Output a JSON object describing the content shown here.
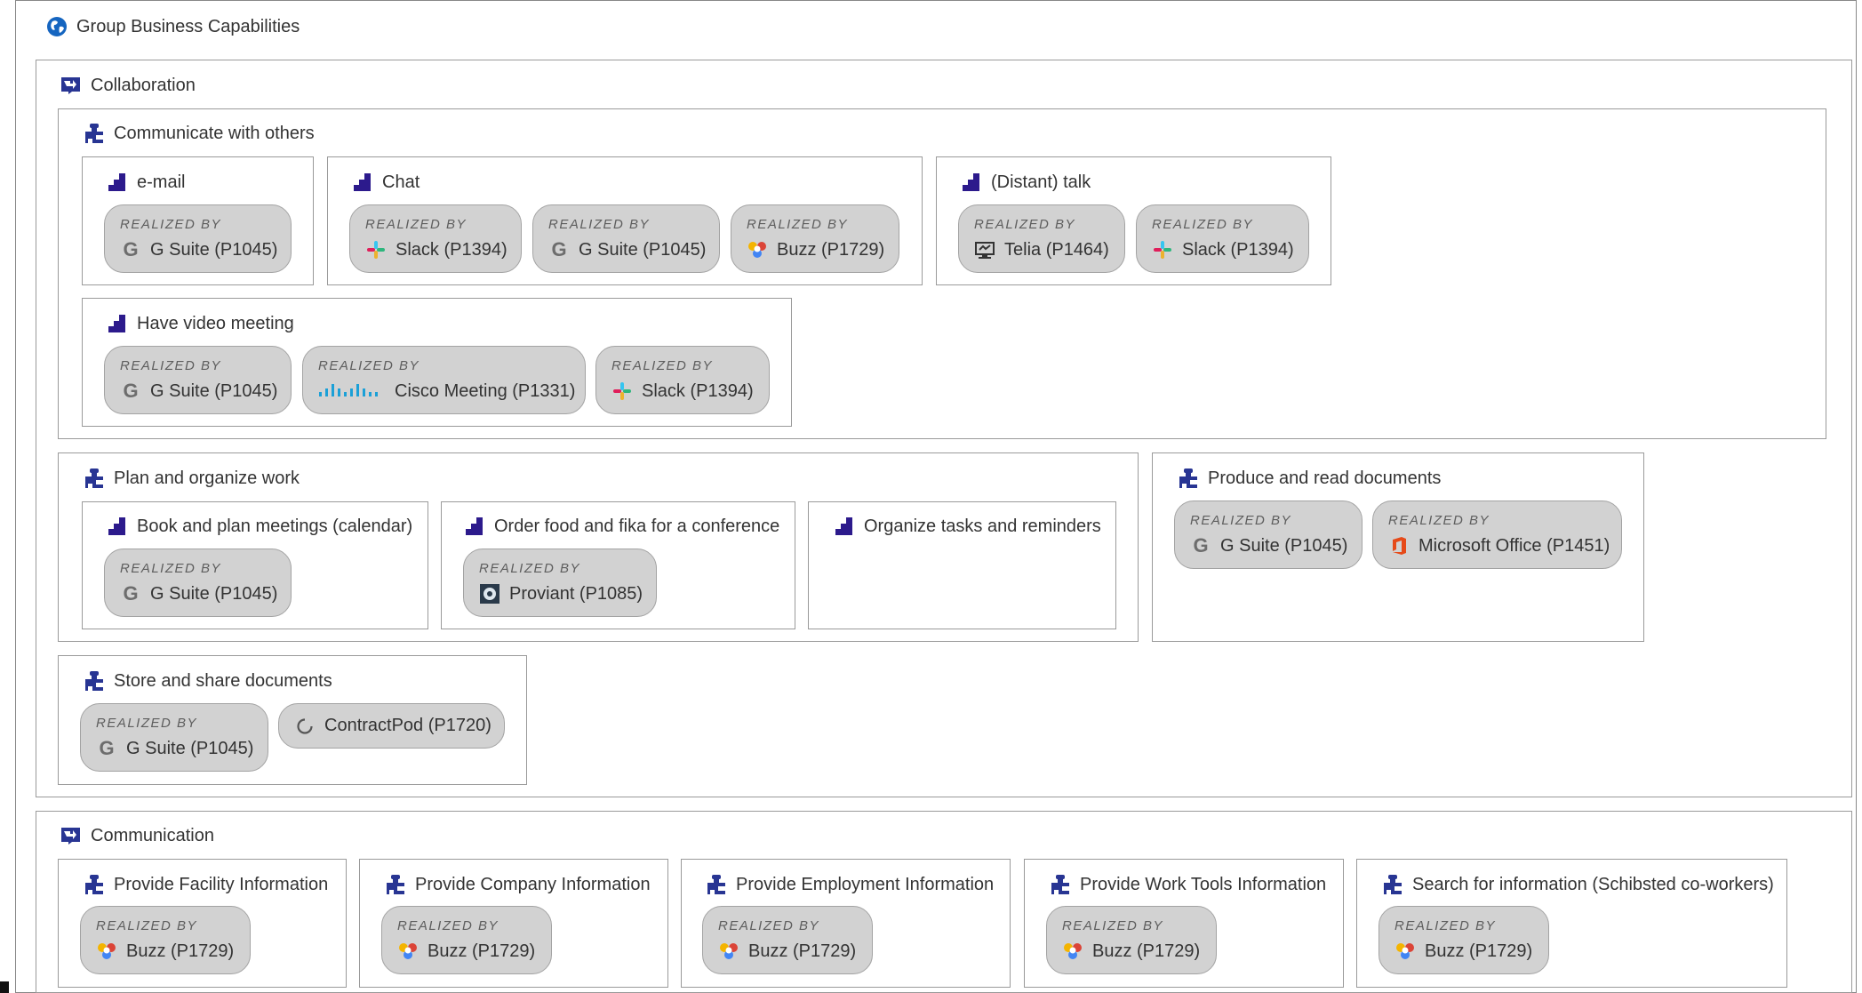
{
  "realized_by_label": "REALIZED BY",
  "root": {
    "title": "Group Business Capabilities",
    "icon": "globe-icon"
  },
  "collaboration": {
    "title": "Collaboration",
    "icon": "domain-icon",
    "communicate": {
      "title": "Communicate with others",
      "icon": "puzzle-icon",
      "email": {
        "title": "e-mail",
        "apps": [
          "G Suite (P1045)"
        ]
      },
      "chat": {
        "title": "Chat",
        "apps": [
          "Slack (P1394)",
          "G Suite (P1045)",
          "Buzz (P1729)"
        ]
      },
      "talk": {
        "title": "(Distant) talk",
        "apps": [
          "Telia (P1464)",
          "Slack (P1394)"
        ]
      },
      "video": {
        "title": "Have video meeting",
        "apps": [
          "G Suite (P1045)",
          "Cisco Meeting (P1331)",
          "Slack (P1394)"
        ]
      }
    },
    "plan": {
      "title": "Plan and organize work",
      "icon": "puzzle-icon",
      "book": {
        "title": "Book and plan meetings (calendar)",
        "apps": [
          "G Suite (P1045)"
        ]
      },
      "food": {
        "title": "Order food and fika for a conference",
        "apps": [
          "Proviant (P1085)"
        ]
      },
      "tasks": {
        "title": "Organize tasks and reminders",
        "apps": []
      }
    },
    "produce": {
      "title": "Produce and read documents",
      "icon": "puzzle-icon",
      "apps": [
        "G Suite (P1045)",
        "Microsoft Office (P1451)"
      ]
    },
    "store": {
      "title": "Store and share documents",
      "icon": "puzzle-icon",
      "apps": [
        "G Suite (P1045)",
        "ContractPod (P1720)"
      ]
    }
  },
  "communication": {
    "title": "Communication",
    "icon": "domain-icon",
    "items": [
      {
        "title": "Provide Facility Information",
        "app": "Buzz (P1729)"
      },
      {
        "title": "Provide Company Information",
        "app": "Buzz (P1729)"
      },
      {
        "title": "Provide Employment Information",
        "app": "Buzz (P1729)"
      },
      {
        "title": "Provide Work Tools Information",
        "app": "Buzz (P1729)"
      },
      {
        "title": "Search for information (Schibsted co-workers)",
        "app": "Buzz (P1729)"
      }
    ]
  },
  "colors": {
    "navy": "#283593",
    "purple": "#2c1a8c",
    "globe": "#1565c0",
    "pill_bg": "#d2d2d2",
    "cisco": "#1ba0d7",
    "office": "#e64a19"
  }
}
